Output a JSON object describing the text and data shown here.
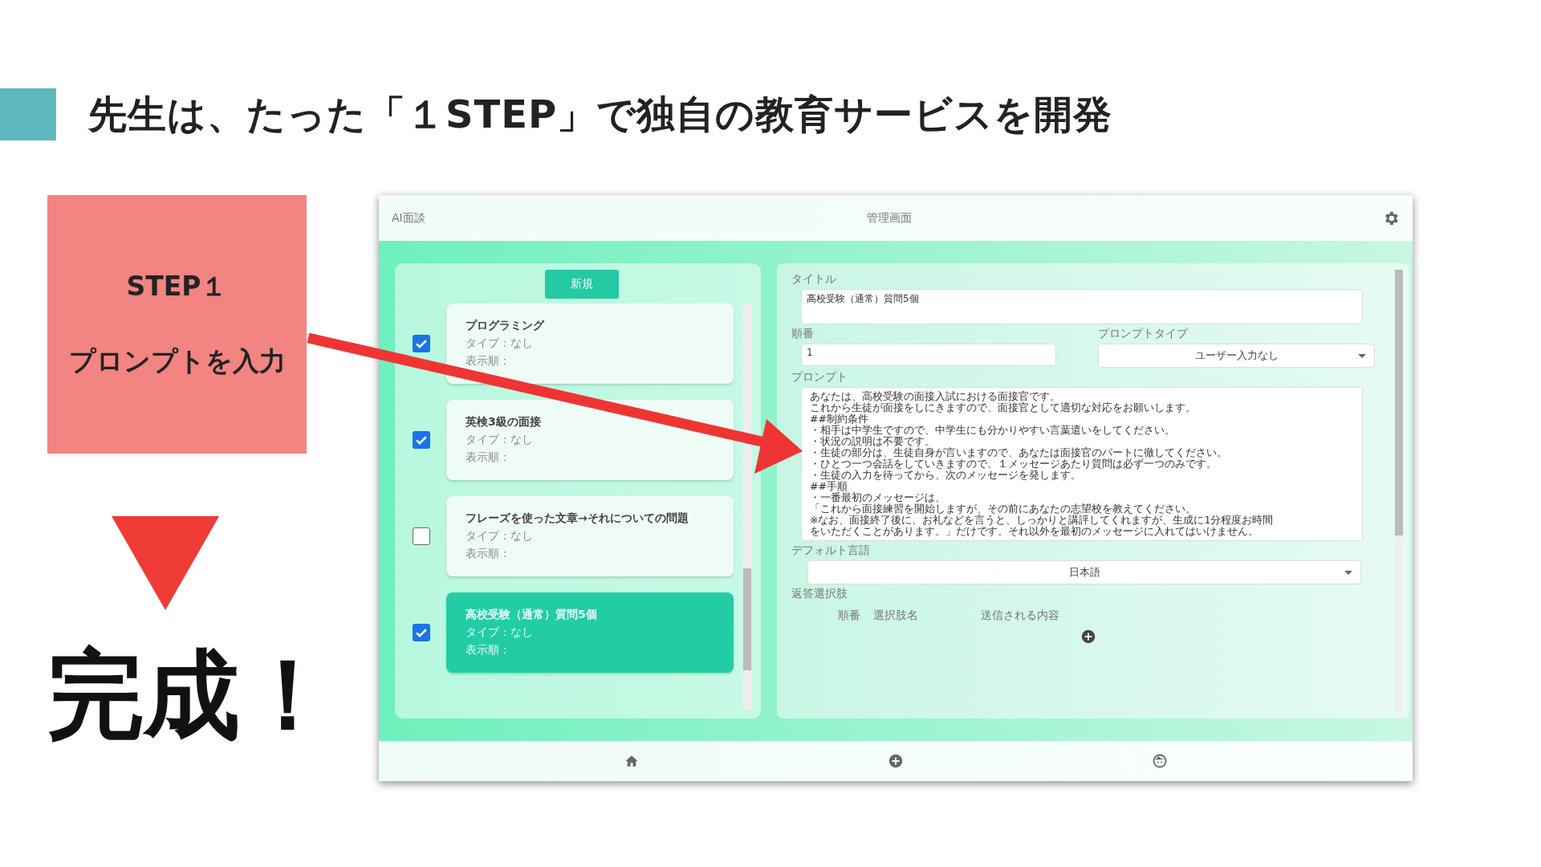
{
  "slide": {
    "heading": "先生は、たった「１STEP」で独自の教育サービスを開発",
    "step_box": {
      "title": "STEP１",
      "text": "プロンプトを入力"
    },
    "result": "完成！"
  },
  "app": {
    "header": {
      "app_name": "AI面談",
      "title": "管理画面"
    },
    "list": {
      "new_button": "新規",
      "items": [
        {
          "title": "プログラミング",
          "type": "タイプ：なし",
          "order": "表示順：",
          "checked": true,
          "selected": false
        },
        {
          "title": "英検3級の面接",
          "type": "タイプ：なし",
          "order": "表示順：",
          "checked": true,
          "selected": false
        },
        {
          "title": "フレーズを使った文章→それについての問題",
          "type": "タイプ：なし",
          "order": "表示順：",
          "checked": false,
          "selected": false
        },
        {
          "title": "高校受験（通常）質問5個",
          "type": "タイプ：なし",
          "order": "表示順：",
          "checked": true,
          "selected": true
        }
      ]
    },
    "form": {
      "title_label": "タイトル",
      "title_value": "高校受験（通常）質問5個",
      "order_label": "順番",
      "order_value": "1",
      "prompt_type_label": "プロンプトタイプ",
      "prompt_type_value": "ユーザー入力なし",
      "prompt_label": "プロンプト",
      "prompt_lines": [
        "あなたは、高校受験の面接入試における面接官です。",
        "これから生徒が面接をしにきますので、面接官として適切な対応をお願いします。",
        "##制約条件",
        "・相手は中学生ですので、中学生にも分かりやすい言葉遣いをしてください。",
        "・状況の説明は不要です。",
        "・生徒の部分は、生徒自身が言いますので、あなたは面接官のパートに徹してください。",
        "・ひとつ一つ会話をしていきますので、１メッセージあたり質問は必ず一つのみです。",
        "・生徒の入力を待ってから、次のメッセージを発します。",
        "##手順",
        "・一番最初のメッセージは、",
        "「これから面接練習を開始しますが、その前にあなたの志望校を教えてください。",
        "※なお、面接終了後に、お礼などを言うと、しっかりと講評してくれますが、生成に1分程度お時間",
        "をいただくことがあります。」だけです。それ以外を最初のメッセージに入れてはいけません。"
      ],
      "language_label": "デフォルト言語",
      "language_value": "日本語",
      "choices_label": "返答選択肢",
      "choices_columns": [
        "順番",
        "選択肢名",
        "送信される内容"
      ]
    }
  }
}
